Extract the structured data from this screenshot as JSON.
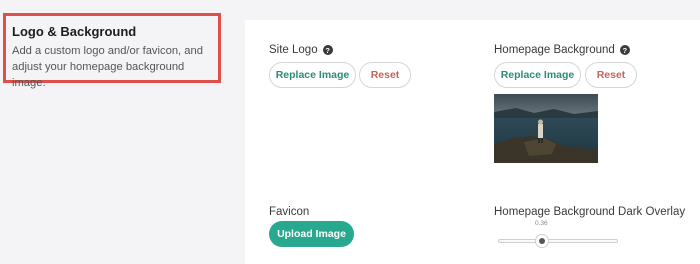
{
  "section": {
    "title": "Logo & Background",
    "description": "Add a custom logo and/or favicon, and adjust your homepage background image."
  },
  "site_logo": {
    "label": "Site Logo",
    "help_icon": "question-circle-icon",
    "replace_label": "Replace Image",
    "reset_label": "Reset"
  },
  "homepage_background": {
    "label": "Homepage Background",
    "help_icon": "question-circle-icon",
    "replace_label": "Replace Image",
    "reset_label": "Reset"
  },
  "favicon": {
    "label": "Favicon",
    "upload_label": "Upload Image"
  },
  "dark_overlay": {
    "label": "Homepage Background Dark Overlay",
    "value_text": "0.36",
    "value": 0.36,
    "min": 0,
    "max": 1
  },
  "colors": {
    "accent": "#27a88f",
    "reset_text": "#c0655f",
    "highlight_border": "#e0504a"
  }
}
